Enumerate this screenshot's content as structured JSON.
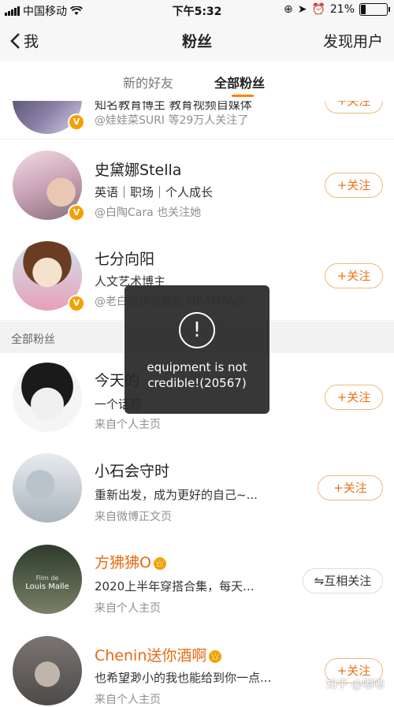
{
  "status_bar": {
    "carrier": "中国移动",
    "time": "下午5:32",
    "battery": "21%"
  },
  "navbar": {
    "back_label": "我",
    "title": "粉丝",
    "right_action": "发现用户"
  },
  "tabs": [
    {
      "label": "新的好友",
      "active": false
    },
    {
      "label": "全部粉丝",
      "active": true
    }
  ],
  "recommended": [
    {
      "name": "",
      "desc": "知名教育博主 教育视频自媒体",
      "sub": "@娃娃菜SURI 等29万人关注了",
      "button": "+关注",
      "verified": true
    },
    {
      "name": "史黛娜Stella",
      "desc": "英语｜职场｜个人成长",
      "sub": "@白陶Cara 也关注她",
      "button": "+关注",
      "verified": true
    },
    {
      "name": "七分向阳",
      "desc": "人文艺术博主",
      "sub": "@老白吃饼宫殿刚-MBAMPAcc...",
      "button": "+关注",
      "verified": true
    }
  ],
  "section_label": "全部粉丝",
  "followers": [
    {
      "name": "今天的",
      "desc": "一个话题",
      "sub": "来自个人主页",
      "button": "+关注"
    },
    {
      "name": "小石会守时",
      "desc": "重新出发，成为更好的自己~...",
      "sub": "来自微博正文页",
      "button": "+关注"
    },
    {
      "name": "方狒狒O",
      "desc": "2020上半年穿搭合集，每天...",
      "sub": "来自个人主页",
      "button": "⇋互相关注",
      "crown": "👑"
    },
    {
      "name": "Chenin送你酒啊",
      "desc": "也希望渺小的我也能给到你一点...",
      "sub": "来自个人主页",
      "button": "+关注",
      "crown": "👑"
    }
  ],
  "avatar_caption": {
    "line1": "Film de",
    "line2": "Louis Malle"
  },
  "toast": {
    "icon": "!",
    "message": "equipment is not credible!(20567)"
  },
  "watermark": "知乎 @嘟嘟"
}
